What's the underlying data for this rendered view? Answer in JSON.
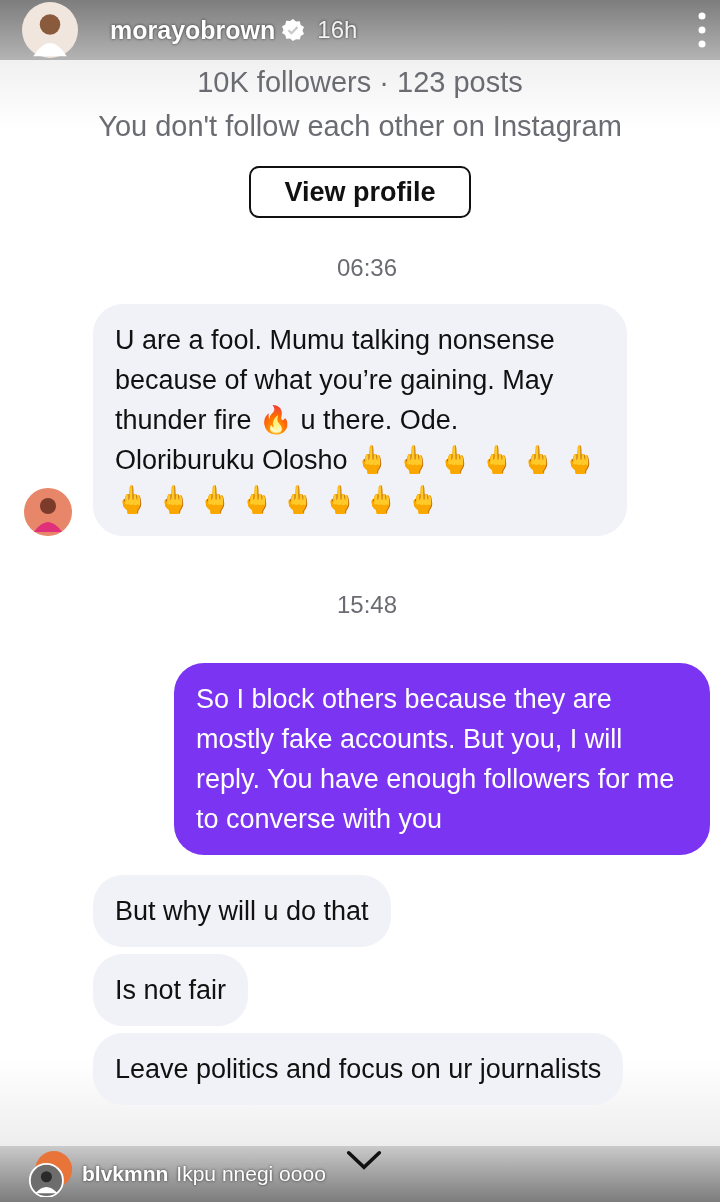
{
  "story_header": {
    "username": "morayobrown",
    "verified": true,
    "time": "16h"
  },
  "profile": {
    "stats": "10K followers · 123 posts",
    "relationship": "You don't follow each other on Instagram",
    "button": "View profile"
  },
  "messages": [
    {
      "kind": "timestamp",
      "text": "06:36"
    },
    {
      "kind": "received",
      "avatar": true,
      "text": "U are a fool.  Mumu talking nonsense because of what you’re gaining.   May thunder fire 🔥 u there. Ode.  Oloriburuku Olosho 🖕 🖕 🖕 🖕 🖕 🖕 🖕 🖕 🖕 🖕 🖕 🖕 🖕 🖕"
    },
    {
      "kind": "timestamp",
      "text": "15:48"
    },
    {
      "kind": "sent",
      "text": "So I block others because they are mostly fake accounts. But you, I will reply. You have enough followers for me to converse with you"
    },
    {
      "kind": "received",
      "avatar": false,
      "text": "But why will u do that"
    },
    {
      "kind": "received",
      "avatar": false,
      "text": "Is not fair"
    },
    {
      "kind": "received",
      "avatar": false,
      "text": "Leave politics and focus on ur journalists"
    }
  ],
  "reply": {
    "username": "blvkmnn",
    "text": "Ikpu nnegi oooo"
  }
}
